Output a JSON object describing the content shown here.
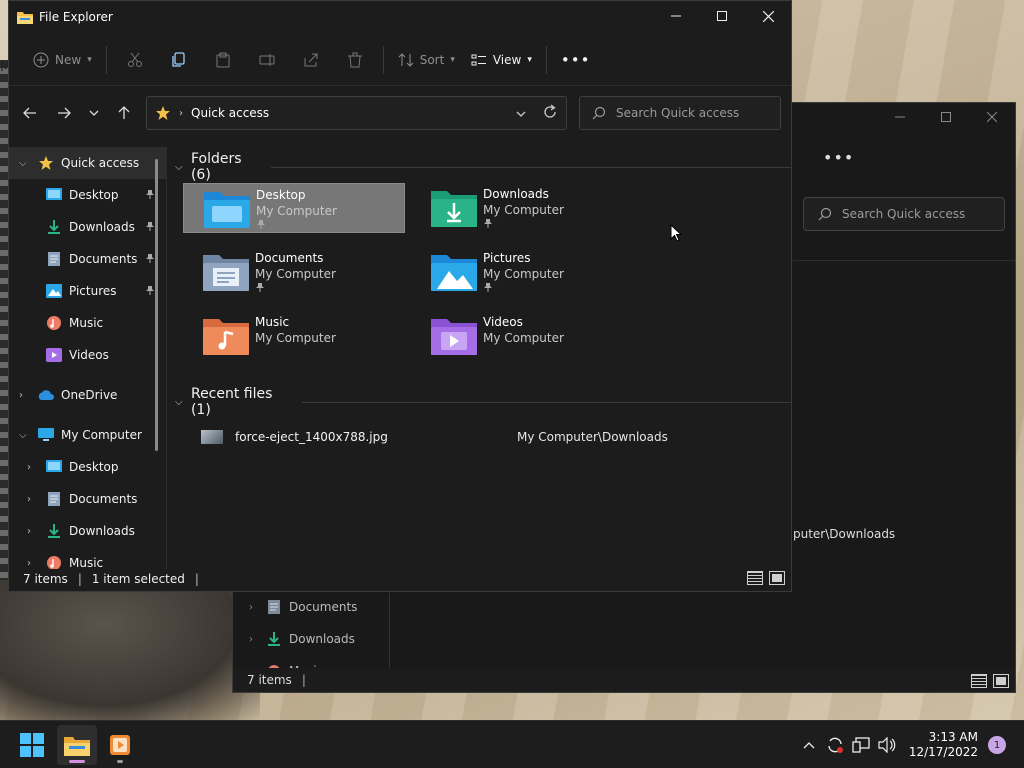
{
  "desktop": {
    "edge_text": "M"
  },
  "back_window": {
    "more_label": "•••",
    "search_placeholder": "Search Quick access",
    "path_fragment": "puter\\Downloads",
    "nav_items": [
      {
        "label": "Documents",
        "icon": "document-icon"
      },
      {
        "label": "Downloads",
        "icon": "download-icon"
      },
      {
        "label": "Music",
        "icon": "music-icon"
      }
    ],
    "status_count": "7 items",
    "status_sep": "|"
  },
  "front_window": {
    "title": "File Explorer",
    "caption_buttons": {
      "minimize": "─",
      "maximize": "☐",
      "close": "✕"
    },
    "command_bar": {
      "new_label": "New",
      "sort_label": "Sort",
      "view_label": "View",
      "more_label": "•••"
    },
    "address": {
      "crumb": "Quick access"
    },
    "search_placeholder": "Search Quick access",
    "sidebar": {
      "items": [
        {
          "label": "Quick access",
          "icon": "star-icon",
          "expander": "v",
          "level": 0,
          "pinned": false,
          "selected": true
        },
        {
          "label": "Desktop",
          "icon": "desktop-icon",
          "expander": "",
          "level": 1,
          "pinned": true
        },
        {
          "label": "Downloads",
          "icon": "download-icon",
          "expander": "",
          "level": 1,
          "pinned": true
        },
        {
          "label": "Documents",
          "icon": "document-icon",
          "expander": "",
          "level": 1,
          "pinned": true
        },
        {
          "label": "Pictures",
          "icon": "pictures-icon",
          "expander": "",
          "level": 1,
          "pinned": true
        },
        {
          "label": "Music",
          "icon": "music-icon",
          "expander": "",
          "level": 1,
          "pinned": false
        },
        {
          "label": "Videos",
          "icon": "videos-icon",
          "expander": "",
          "level": 1,
          "pinned": false
        },
        {
          "label": "OneDrive",
          "icon": "cloud-icon",
          "expander": ">",
          "level": 0,
          "pinned": false,
          "gap_before": true
        },
        {
          "label": "My Computer",
          "icon": "computer-icon",
          "expander": "v",
          "level": 0,
          "pinned": false,
          "gap_before": true
        },
        {
          "label": "Desktop",
          "icon": "desktop-icon",
          "expander": ">",
          "level": 1,
          "pinned": false
        },
        {
          "label": "Documents",
          "icon": "document-icon",
          "expander": ">",
          "level": 1,
          "pinned": false
        },
        {
          "label": "Downloads",
          "icon": "download-icon",
          "expander": ">",
          "level": 1,
          "pinned": false
        },
        {
          "label": "Music",
          "icon": "music-icon",
          "expander": ">",
          "level": 1,
          "pinned": false
        }
      ]
    },
    "folders_group": {
      "title": "Folders (6)"
    },
    "folders": [
      {
        "name": "Desktop",
        "location": "My Computer",
        "pinned": true,
        "icon": "desktop-folder-icon",
        "selected": true
      },
      {
        "name": "Downloads",
        "location": "My Computer",
        "pinned": true,
        "icon": "downloads-folder-icon"
      },
      {
        "name": "Documents",
        "location": "My Computer",
        "pinned": true,
        "icon": "documents-folder-icon"
      },
      {
        "name": "Pictures",
        "location": "My Computer",
        "pinned": true,
        "icon": "pictures-folder-icon"
      },
      {
        "name": "Music",
        "location": "My Computer",
        "pinned": false,
        "icon": "music-folder-icon"
      },
      {
        "name": "Videos",
        "location": "My Computer",
        "pinned": false,
        "icon": "videos-folder-icon"
      }
    ],
    "recent_group": {
      "title": "Recent files (1)"
    },
    "recent_files": [
      {
        "name": "force-eject_1400x788.jpg",
        "path": "My Computer\\Downloads"
      }
    ],
    "status": {
      "count": "7 items",
      "selection": "1 item selected",
      "sep": "|"
    }
  },
  "taskbar": {
    "apps": [
      {
        "name": "file-explorer",
        "active": true
      },
      {
        "name": "media-player",
        "active": false
      }
    ],
    "clock": {
      "time": "3:13 AM",
      "date": "12/17/2022"
    },
    "notification_count": "1"
  },
  "colors": {
    "folder_yellow": "#f4c04a",
    "desktop_blue": "#2ba8e8",
    "downloads_green": "#2ab387",
    "documents_gray": "#8ea4bf",
    "music_orange": "#ef8a5b",
    "videos_purple": "#a56ee6",
    "pin_gray": "#aaaaaa",
    "selected_tile": "#777777"
  }
}
